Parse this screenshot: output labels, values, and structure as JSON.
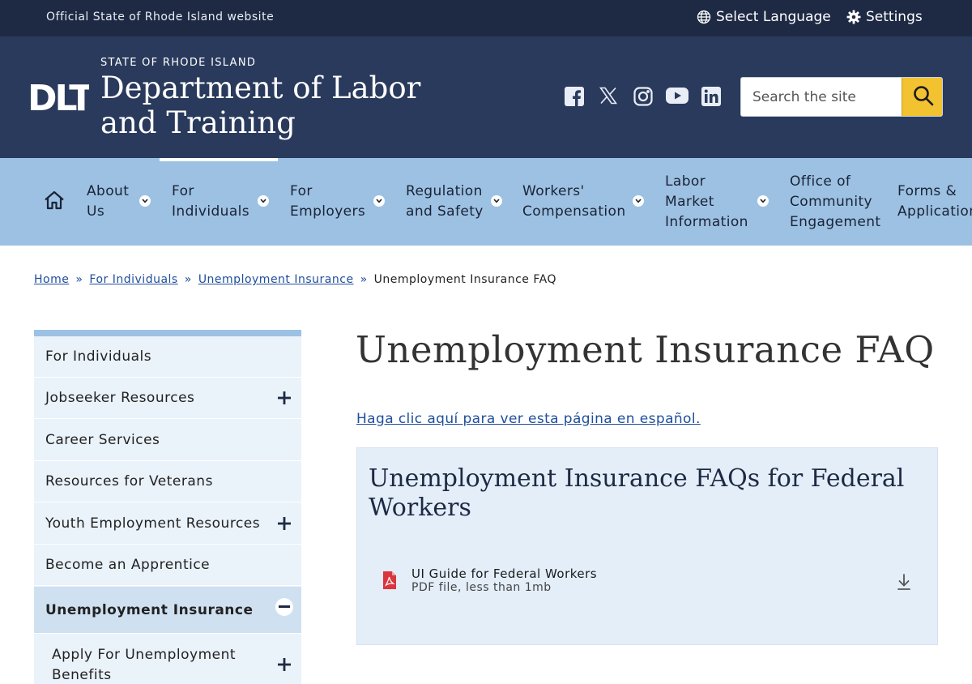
{
  "utility": {
    "official_text": "Official State of Rhode Island website",
    "language_label": "Select Language",
    "settings_label": "Settings"
  },
  "header": {
    "logo_text": "DLT",
    "state_name": "STATE OF RHODE ISLAND",
    "department_name": "Department of Labor and Training",
    "social_icons": [
      "facebook-icon",
      "x-icon",
      "instagram-icon",
      "youtube-icon",
      "linkedin-icon"
    ],
    "search": {
      "placeholder": "Search the site",
      "value": ""
    }
  },
  "nav": {
    "items": [
      {
        "label": "About Us"
      },
      {
        "label": "For Individuals"
      },
      {
        "label": "For Employers"
      },
      {
        "label": "Regulation and Safety"
      },
      {
        "label": "Workers' Compensation"
      },
      {
        "label": "Labor Market Information"
      },
      {
        "label": "Office of Community Engagement"
      },
      {
        "label": "Forms & Applications"
      }
    ],
    "active": "For Individuals"
  },
  "breadcrumb": {
    "items": [
      "Home",
      "For Individuals",
      "Unemployment Insurance"
    ],
    "current": "Unemployment Insurance FAQ",
    "separator": "»"
  },
  "sidebar": {
    "items": [
      {
        "label": "For Individuals"
      },
      {
        "label": "Jobseeker Resources"
      },
      {
        "label": "Career Services"
      },
      {
        "label": "Resources for Veterans"
      },
      {
        "label": "Youth Employment Resources"
      },
      {
        "label": "Become an Apprentice"
      },
      {
        "label": "Unemployment Insurance"
      }
    ],
    "sub_item": "Apply For Unemployment Benefits"
  },
  "main": {
    "title": "Unemployment Insurance FAQ",
    "spanish_link": "Haga clic aquí para ver esta página en español.",
    "federal_box": {
      "title": "Unemployment Insurance FAQs for Federal Workers",
      "file_name": "UI Guide for Federal Workers",
      "file_meta": "PDF file, less than 1mb"
    }
  },
  "colors": {
    "utility_bg": "#1e2a44",
    "header_bg": "#2a3a5c",
    "nav_bg": "#9dc1e3",
    "search_button": "#f2c230",
    "sidebar_bg": "#eaf2fa",
    "link": "#1f4e9c",
    "pdf_icon": "#d9363e"
  }
}
